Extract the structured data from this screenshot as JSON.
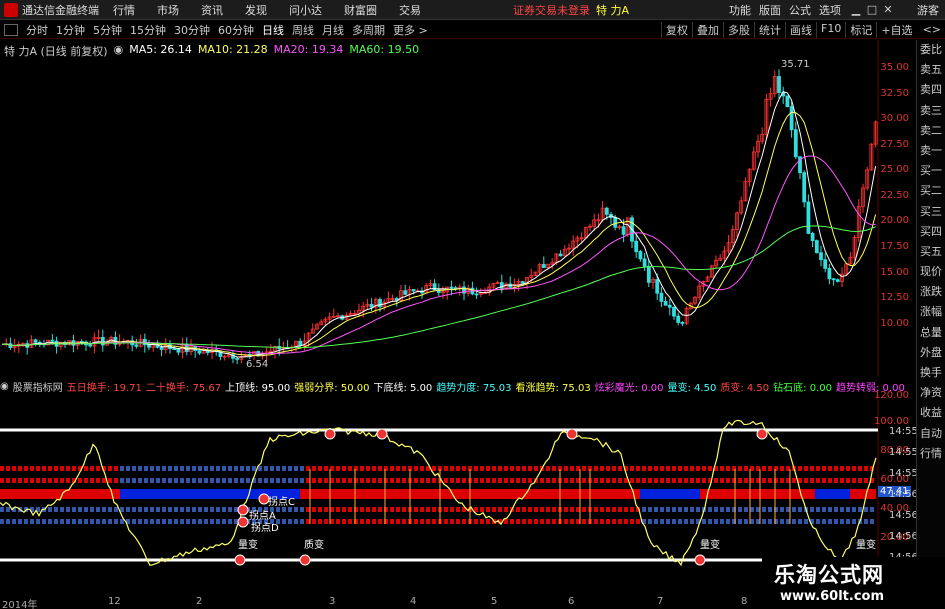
{
  "menubar": {
    "title": "通达信金融终端",
    "items": [
      "行情",
      "市场",
      "资讯",
      "发现",
      "问小达",
      "财富圈",
      "交易"
    ],
    "notice": "证券交易未登录",
    "stock": "特 力A",
    "right_items": [
      "功能",
      "版面",
      "公式",
      "选项"
    ],
    "guest": "游客"
  },
  "periodbar": {
    "items": [
      "分时",
      "1分钟",
      "5分钟",
      "15分钟",
      "30分钟",
      "60分钟",
      "日线",
      "周线",
      "月线",
      "多周期",
      "更多 >"
    ],
    "active_index": 6,
    "tools": [
      "复权",
      "叠加",
      "多股",
      "统计",
      "画线",
      "F10",
      "标记",
      "+自选"
    ],
    "zoom": "<>"
  },
  "ma_legend": {
    "stock": "特 力A (日线 前复权)",
    "items": [
      {
        "text": "MA5: 26.14",
        "color": "#ffffff"
      },
      {
        "text": "MA10: 21.28",
        "color": "#ffff55"
      },
      {
        "text": "MA20: 19.34",
        "color": "#ff55ff"
      },
      {
        "text": "MA60: 19.50",
        "color": "#55ff55"
      }
    ]
  },
  "main_axis": [
    "35.00",
    "32.50",
    "30.00",
    "27.50",
    "25.00",
    "22.50",
    "20.00",
    "17.50",
    "15.00",
    "12.50",
    "10.00"
  ],
  "price_marks": {
    "high": "35.71",
    "low": "6.54"
  },
  "indicator_header": [
    {
      "text": "股票指标网",
      "color": "#cccccc"
    },
    {
      "text": "五日换手: 19.71",
      "color": "#ff4444"
    },
    {
      "text": "二十换手: 75.67",
      "color": "#ff4444"
    },
    {
      "text": "上顶线: 95.00",
      "color": "#ffffff"
    },
    {
      "text": "强弱分界: 50.00",
      "color": "#ffff44"
    },
    {
      "text": "下底线: 5.00",
      "color": "#ffffff"
    },
    {
      "text": "趋势力度: 75.03",
      "color": "#44ffff"
    },
    {
      "text": "看涨趋势: 75.03",
      "color": "#ffff44"
    },
    {
      "text": "炫彩魔光: 0.00",
      "color": "#ff44ff"
    },
    {
      "text": "量变: 4.50",
      "color": "#44ffff"
    },
    {
      "text": "质变: 4.50",
      "color": "#ff4444"
    },
    {
      "text": "钻石底: 0.00",
      "color": "#44ff44"
    },
    {
      "text": "趋势转弱: 0.00",
      "color": "#ff44ff"
    }
  ],
  "ind_axis": [
    "120.00",
    "100.00",
    "80.00",
    "60.00",
    "40.00",
    "20.00"
  ],
  "ind_labels": {
    "zhaodian_c": "拐点C",
    "zhaodian_a": "拐点A",
    "zhaodian_d": "拐点D",
    "liangbian": "量变",
    "zhibian": "质变",
    "value_tag": "47.41"
  },
  "right_times": [
    "14:55",
    "14:55",
    "14:55",
    "14:56",
    "14:56",
    "14:56",
    "14:56"
  ],
  "side_panel": [
    "委比",
    "卖五",
    "卖四",
    "卖三",
    "卖二",
    "卖一",
    "买一",
    "买二",
    "买三",
    "买四",
    "买五",
    "现价",
    "涨跌",
    "涨幅",
    "总量",
    "外盘",
    "换手",
    "净资",
    "收益",
    "自动",
    "行情"
  ],
  "date_labels": [
    "2014年",
    "12",
    "2",
    "3",
    "4",
    "5",
    "6",
    "7",
    "8"
  ],
  "watermark": {
    "line1": "乐淘公式网",
    "line2": "www.60lt.com"
  },
  "colors": {
    "up": "#ff3333",
    "down": "#33dddd",
    "red_band": "#dd0000",
    "blue_band": "#0022dd"
  }
}
